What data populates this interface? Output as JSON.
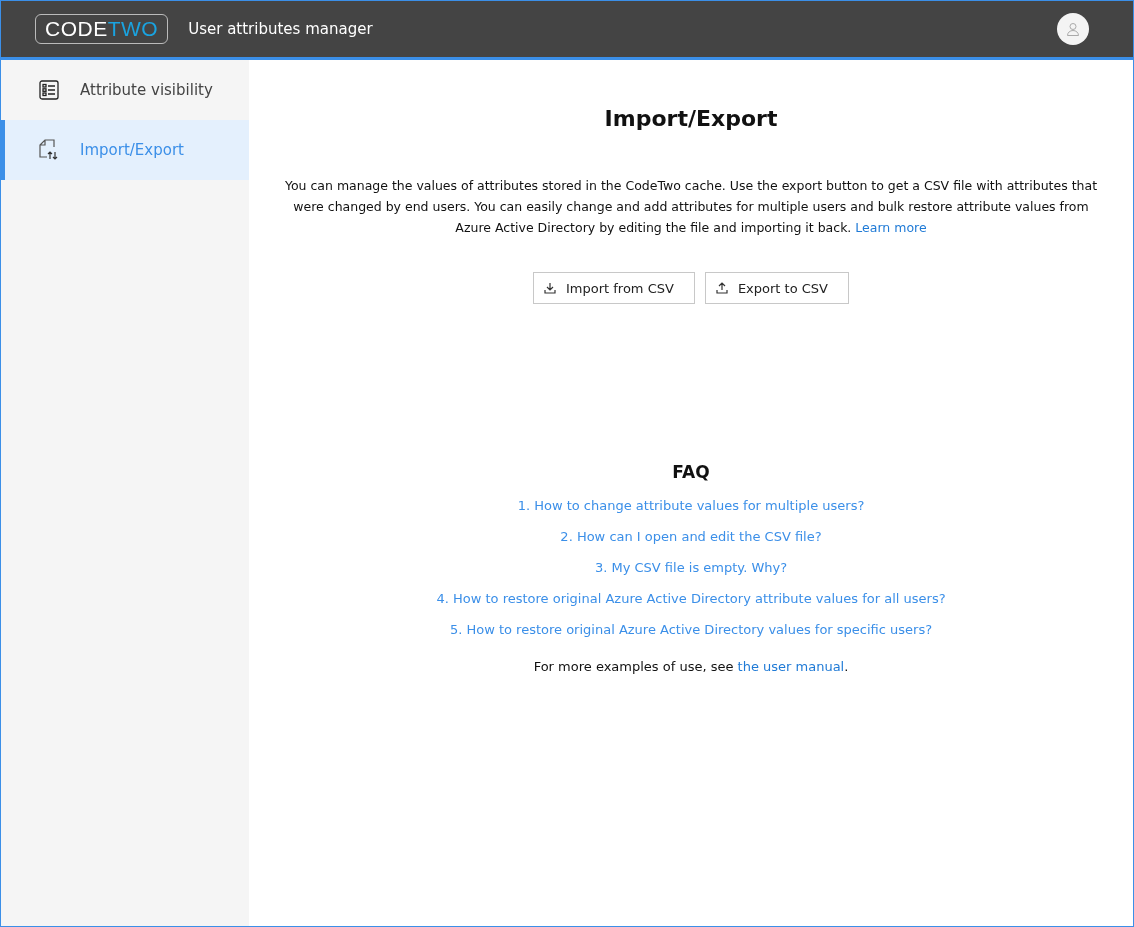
{
  "header": {
    "logo": {
      "first": "CODE",
      "second": "TWO"
    },
    "title": "User attributes manager"
  },
  "sidebar": {
    "items": [
      {
        "label": "Attribute visibility",
        "selected": false
      },
      {
        "label": "Import/Export",
        "selected": true
      }
    ]
  },
  "main": {
    "heading": "Import/Export",
    "description": "You can manage the values of attributes stored in the CodeTwo cache. Use the export button to get a CSV file with attributes that were changed by end users. You can easily change and add attributes for multiple users and bulk restore attribute values from Azure Active Directory by editing the file and importing it back.",
    "learn_more": "Learn more",
    "buttons": [
      {
        "label": "Import from CSV"
      },
      {
        "label": "Export to CSV"
      }
    ],
    "faq": {
      "heading": "FAQ",
      "links": [
        "1. How to change attribute values for multiple users?",
        "2. How can I open and edit the CSV file?",
        "3. My CSV file is empty. Why?",
        "4. How to restore original Azure Active Directory attribute values for all users?",
        "5. How to restore original Azure Active Directory values for specific users?"
      ],
      "footer_text": "For more examples of use, see",
      "footer_link": "the user manual",
      "footer_end": "."
    }
  }
}
